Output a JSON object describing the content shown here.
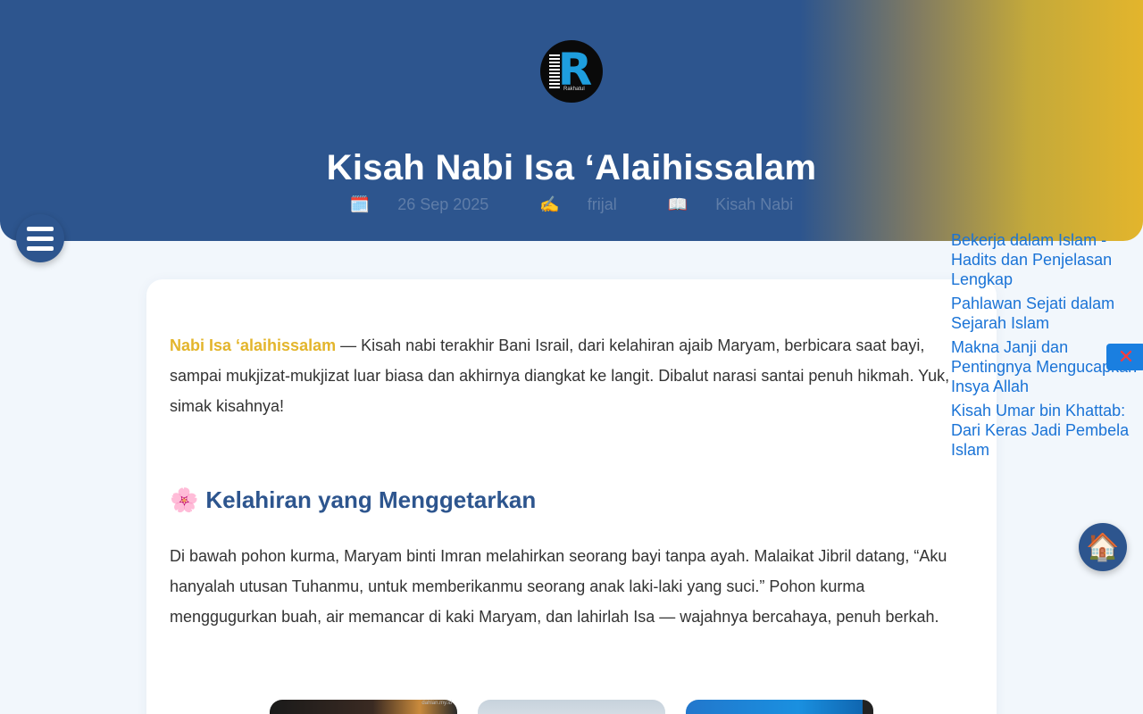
{
  "header": {
    "logo_text": "R",
    "logo_subtext": "Rakhatul",
    "title": "Kisah Nabi Isa ‘Alaihissalam",
    "meta": {
      "date_icon": "🗓️",
      "date": "26 Sep 2025",
      "author_icon": "✍️",
      "author": "frijal",
      "category_icon": "📖",
      "category": "Kisah Nabi"
    }
  },
  "article": {
    "intro_highlight": "Nabi Isa ‘alaihissalam",
    "intro_text": " — Kisah nabi terakhir Bani Israil, dari kelahiran ajaib Maryam, berbicara saat bayi, sampai mukjizat-mukjizat luar biasa dan akhirnya diangkat ke langit. Dibalut narasi santai penuh hikmah. Yuk, simak kisahnya!",
    "section_icon": "🌸",
    "section_title": "Kelahiran yang Menggetarkan",
    "paragraph": "Di bawah pohon kurma, Maryam binti Imran melahirkan seorang bayi tanpa ayah. Malaikat Jibril datang, “Aku hanyalah utusan Tuhanmu, untuk memberikanmu seorang anak laki-laki yang suci.” Pohon kurma menggugurkan buah, air memancar di kaki Maryam, dan lahirlah Isa — wajahnya bercahaya, penuh berkah.",
    "thumbnail_watermark": "dahlan.my.id"
  },
  "related": [
    "Bekerja dalam Islam - Hadits dan Penjelasan Lengkap",
    "Pahlawan Sejati dalam Sejarah Islam",
    "Makna Janji dan Pentingnya Mengucapkan Insya Allah",
    "Kisah Umar bin Khattab: Dari Keras Jadi Pembela Islam"
  ],
  "controls": {
    "close_symbol": "✕",
    "home_icon": "🏠"
  },
  "colors": {
    "brand_blue": "#2d558e",
    "accent_gold": "#e3b52c",
    "link_blue": "#1a73d6"
  }
}
